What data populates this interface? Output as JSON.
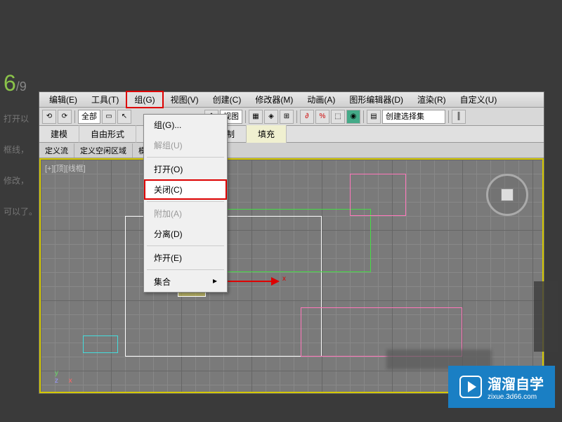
{
  "page": {
    "step_num": "6",
    "step_total": "/9",
    "desc_1": "打开以",
    "desc_2": "框线，",
    "desc_3": "修改，",
    "desc_4": "可以了。"
  },
  "menubar": {
    "edit": "编辑(E)",
    "tools": "工具(T)",
    "group": "组(G)",
    "view": "视图(V)",
    "create": "创建(C)",
    "modifier": "修改器(M)",
    "anim": "动画(A)",
    "graph": "图形编辑器(D)",
    "render": "渲染(R)",
    "custom": "自定义(U)"
  },
  "toolbar": {
    "all": "全部",
    "view_dd": "视图",
    "selset": "创建选择集"
  },
  "ribbon": {
    "model": "建模",
    "freeform": "自由形式",
    "draw": "绘制",
    "fill": "填充"
  },
  "subrow": {
    "flow": "定义流",
    "area": "定义空闲区域",
    "sim": "模拟"
  },
  "viewport": {
    "label": "[+][顶][线框]",
    "x": "x",
    "y": "y",
    "z": "z",
    "x2": "x"
  },
  "dropdown": {
    "group": "组(G)...",
    "ungroup": "解组(U)",
    "open": "打开(O)",
    "close": "关闭(C)",
    "attach": "附加(A)",
    "detach": "分离(D)",
    "explode": "炸开(E)",
    "assembly": "集合"
  },
  "watermark": {
    "brand": "溜溜自学",
    "url": "zixue.3d66.com"
  }
}
